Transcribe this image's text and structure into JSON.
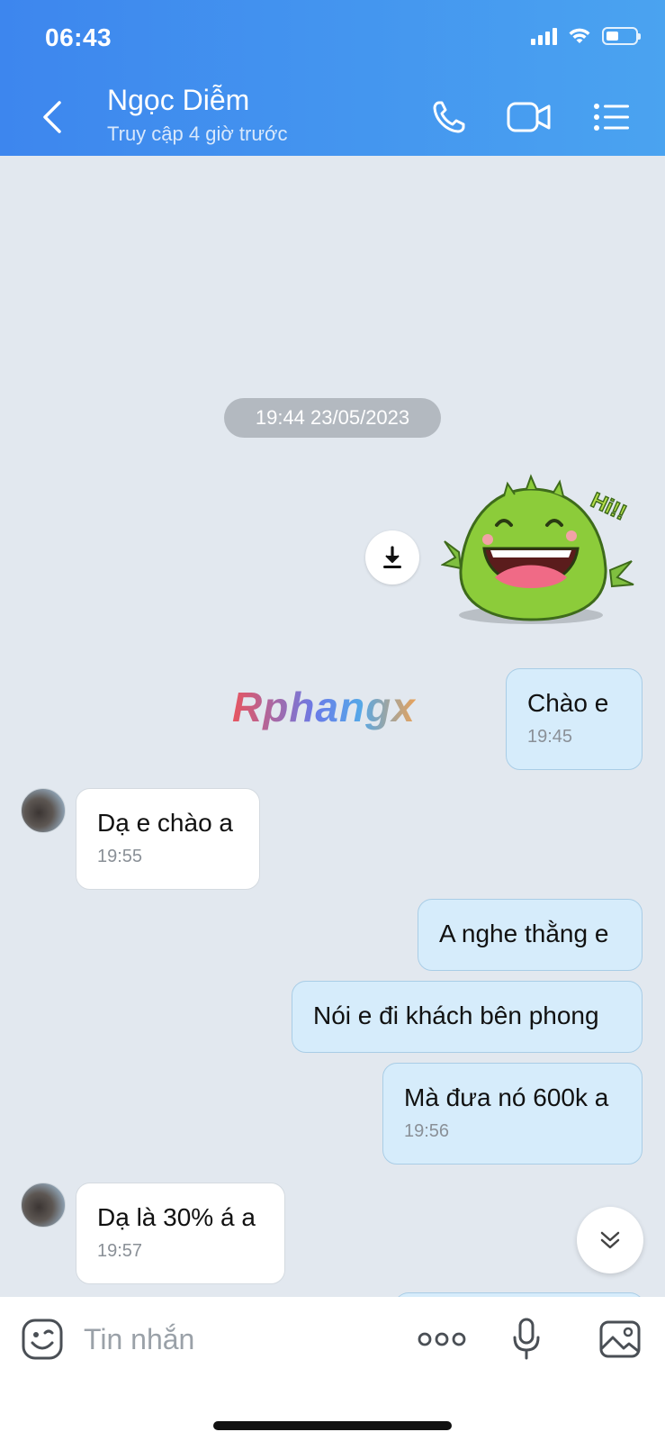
{
  "status_bar": {
    "time": "06:43"
  },
  "header": {
    "contact_name": "Ngọc Diễm",
    "contact_status": "Truy cập 4 giờ trước",
    "icons": [
      "back-icon",
      "phone-icon",
      "video-call-icon",
      "menu-list-icon"
    ]
  },
  "chat": {
    "date_separator": "19:44 23/05/2023",
    "sticker": {
      "caption": "Hi!!"
    },
    "watermark": "Rphangx",
    "messages": [
      {
        "dir": "out",
        "text": "Chào e",
        "time": "19:45"
      },
      {
        "dir": "in",
        "text": "Dạ e chào a",
        "time": "19:55"
      },
      {
        "dir": "out",
        "text": "A nghe thằng e"
      },
      {
        "dir": "out",
        "text": "Nói e đi khách bên phong"
      },
      {
        "dir": "out",
        "text": "Mà đưa nó 600k a",
        "time": "19:56"
      },
      {
        "dir": "in",
        "text": "Dạ là 30% á a",
        "time": "19:57"
      }
    ]
  },
  "composer": {
    "placeholder": "Tin nhắn",
    "icons": [
      "emoji-icon",
      "more-icon",
      "microphone-icon",
      "image-icon"
    ]
  },
  "colors": {
    "header_start": "#3d86ee",
    "header_end": "#4aa3f0",
    "chat_bg": "#e2e8ef",
    "outgoing_bubble": "#d6ecfb",
    "incoming_bubble": "#ffffff"
  }
}
